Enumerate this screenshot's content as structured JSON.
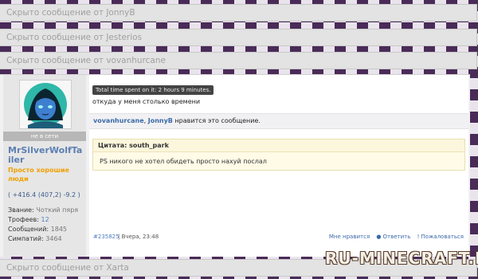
{
  "hidden_posts": [
    {
      "label": "Скрыто сообщение от JonnyB"
    },
    {
      "label": "Скрыто сообщение от Jesterios"
    },
    {
      "label": "Скрыто сообщение от vovanhurcane"
    },
    {
      "label": "Скрыто сообщение от Xarta"
    }
  ],
  "user": {
    "status": "не в сети",
    "name": "MrSilverWolfTailer",
    "title": "Просто хорошие люди",
    "reputation": "( +416.4 (407,2) -9.2 )",
    "stats": [
      {
        "label": "Звание:",
        "value": "Чоткий пяря",
        "style": "v"
      },
      {
        "label": "Трофеев:",
        "value": "12",
        "style": "link"
      },
      {
        "label": "Сообщений:",
        "value": "1845",
        "style": "v"
      },
      {
        "label": "Симпатий:",
        "value": "3464",
        "style": "v"
      }
    ]
  },
  "post": {
    "time_badge": "Total time spent on it:  2 hours 9 minutes.",
    "message": "откуда у меня столько времени",
    "likes": {
      "user1": "vovanhurcane",
      "sep": ", ",
      "user2": "JonnyB",
      "suffix": " нравится это сообщение."
    },
    "quote": {
      "header": "Цитата: south_park",
      "body": "PS никого не хотел обидеть просто нахуй послал"
    },
    "number": "#235825",
    "date": "| Вчера, 23:48",
    "actions": {
      "like": "Мне нравится",
      "reply": "Ответить",
      "report": "Пожаловаться"
    }
  },
  "watermark": "RU-MINECRAFT.RU",
  "colors": {
    "accent": "#3b6aa8",
    "username": "#5c7fb3",
    "title": "#f0a000",
    "quote_bg": "#fffbe7"
  }
}
